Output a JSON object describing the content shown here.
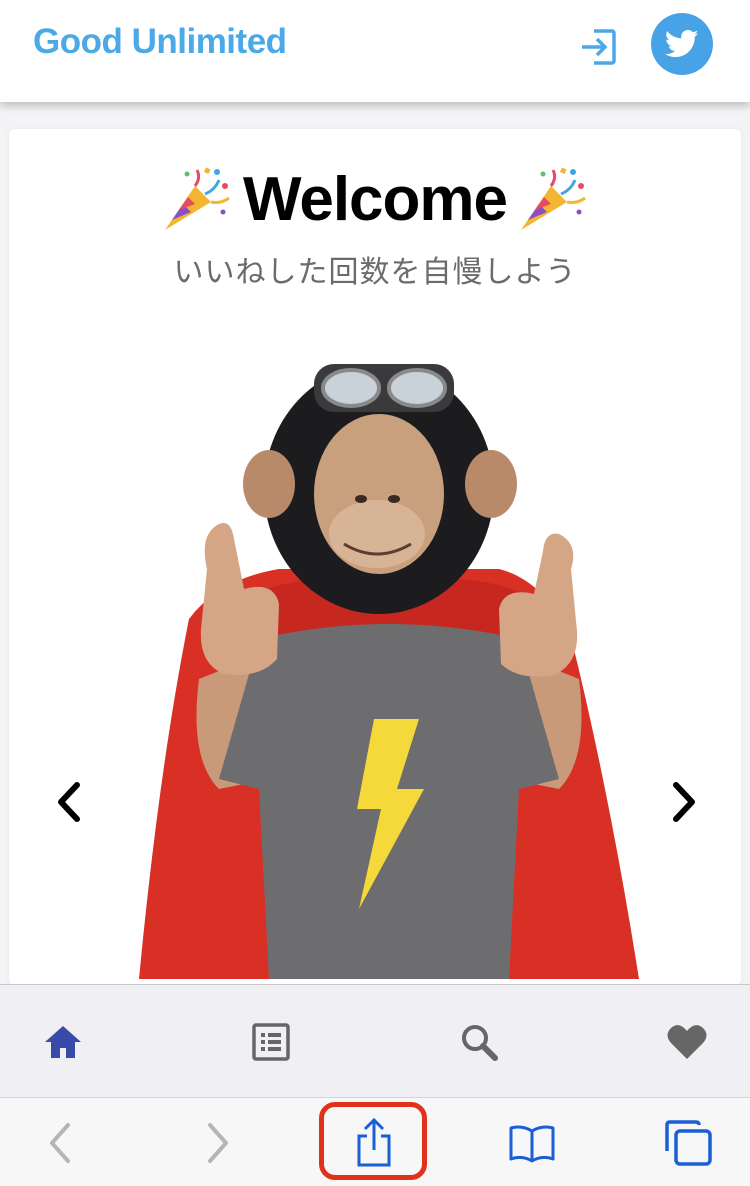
{
  "header": {
    "brand": "Good Unlimited",
    "icons": {
      "login": "login-icon",
      "twitter": "twitter-icon"
    },
    "brand_color": "#4aa9e6",
    "twitter_color": "#47a3e6"
  },
  "card": {
    "title": "Welcome",
    "title_emoji": "party-popper-icon",
    "subtitle": "いいねした回数を自慢しよう",
    "hero_image": "monkey-mask-superhero-thumbs-up"
  },
  "carousel": {
    "prev_icon": "chevron-left-icon",
    "next_icon": "chevron-right-icon"
  },
  "app_nav": {
    "items": [
      {
        "name": "home",
        "icon": "home-icon",
        "active": true
      },
      {
        "name": "list",
        "icon": "list-icon",
        "active": false
      },
      {
        "name": "search",
        "icon": "search-icon",
        "active": false
      },
      {
        "name": "favorites",
        "icon": "heart-icon",
        "active": false
      }
    ],
    "active_color": "#3a4aa8",
    "inactive_color": "#666666"
  },
  "browser_toolbar": {
    "items": [
      "back-icon",
      "forward-icon",
      "share-icon",
      "bookmarks-icon",
      "tabs-icon"
    ],
    "accent": "#1a5fd6",
    "highlight_color": "#e0321b"
  }
}
